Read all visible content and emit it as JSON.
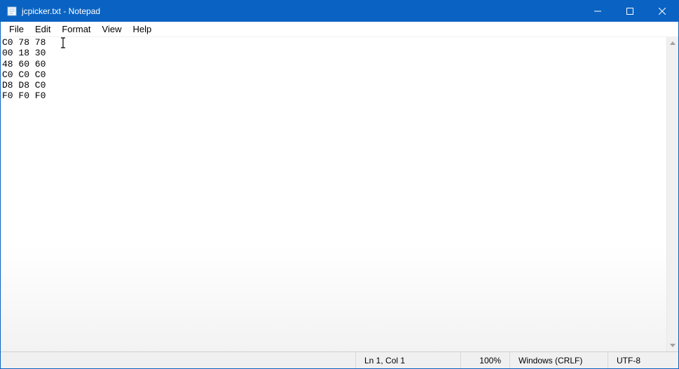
{
  "titlebar": {
    "title": "jcpicker.txt - Notepad"
  },
  "menubar": {
    "file": "File",
    "edit": "Edit",
    "format": "Format",
    "view": "View",
    "help": "Help"
  },
  "editor": {
    "content": "C0 78 78\n00 18 30\n48 60 60\nC0 C0 C0\nD8 D8 C0\nF0 F0 F0"
  },
  "statusbar": {
    "position": "Ln 1, Col 1",
    "zoom": "100%",
    "line_ending": "Windows (CRLF)",
    "encoding": "UTF-8"
  }
}
